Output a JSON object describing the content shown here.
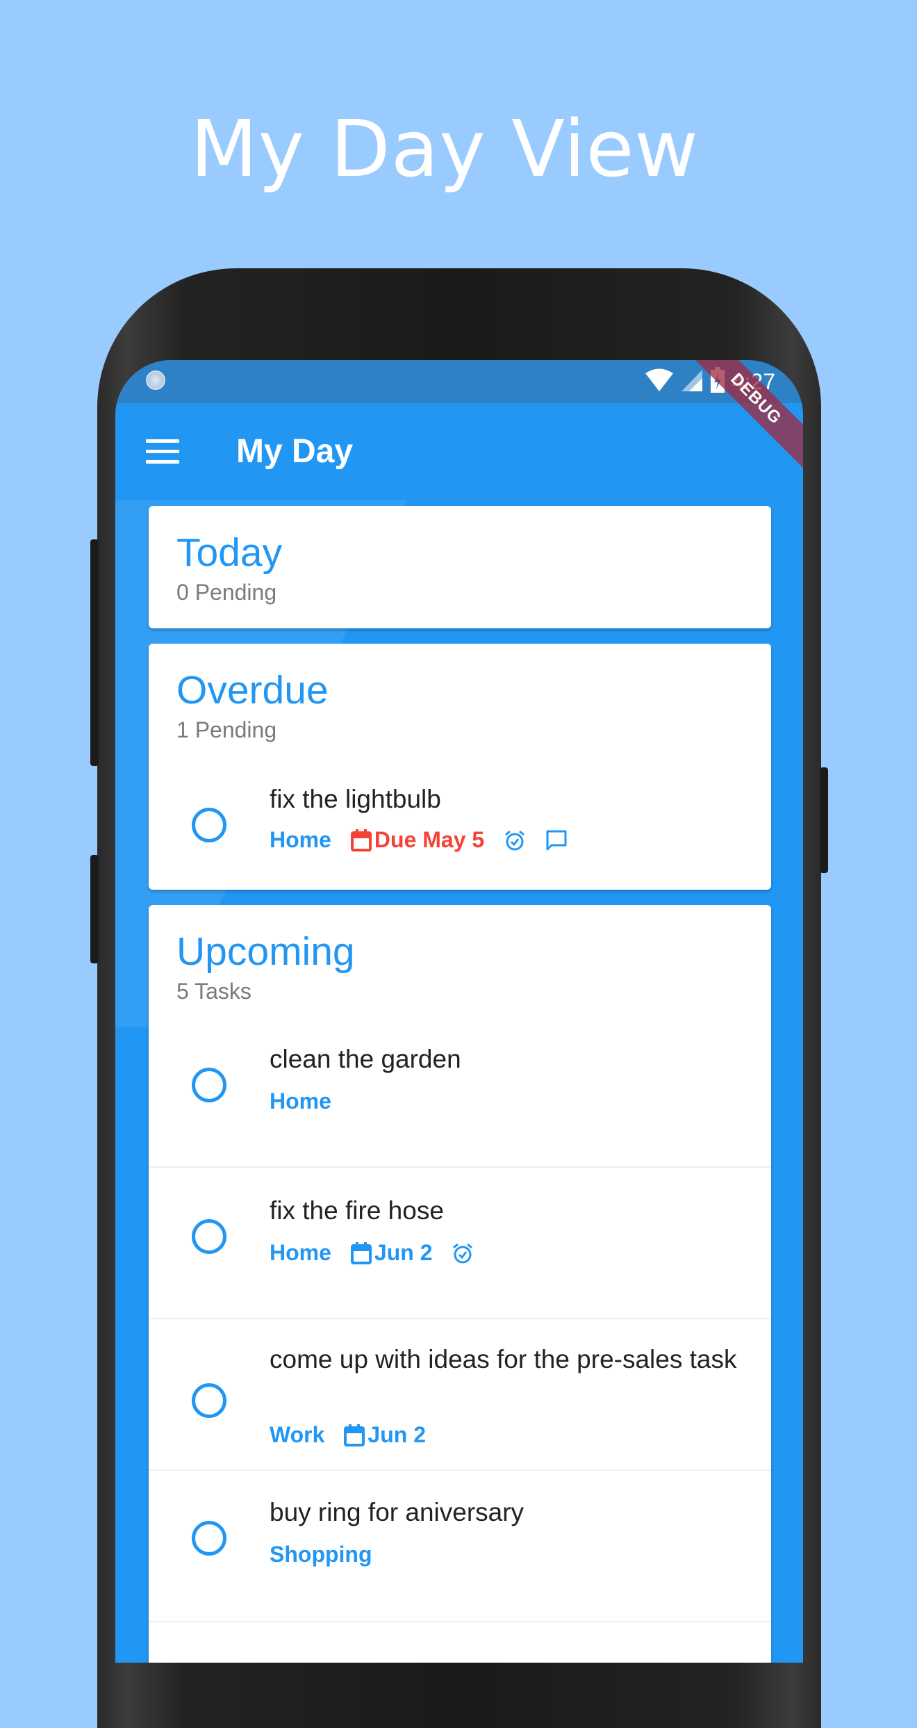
{
  "promo": {
    "title": "My Day View"
  },
  "status_bar": {
    "time": "4:27",
    "debug_label": "DEBUG"
  },
  "app_bar": {
    "title": "My Day"
  },
  "sections": {
    "today": {
      "title": "Today",
      "subtitle": "0 Pending"
    },
    "overdue": {
      "title": "Overdue",
      "subtitle": "1 Pending",
      "tasks": [
        {
          "name": "fix the lightbulb",
          "list": "Home",
          "due": "Due May 5",
          "has_reminder": true,
          "has_comment": true
        }
      ]
    },
    "upcoming": {
      "title": "Upcoming",
      "subtitle": "5 Tasks",
      "tasks": [
        {
          "name": "clean the garden",
          "list": "Home"
        },
        {
          "name": "fix the fire hose",
          "list": "Home",
          "due": "Jun 2",
          "has_reminder": true
        },
        {
          "name": "come up with ideas for the pre-sales task",
          "list": "Work",
          "due": "Jun 2"
        },
        {
          "name": "buy ring for aniversary",
          "list": "Shopping"
        }
      ]
    }
  },
  "colors": {
    "accent": "#2196f3",
    "overdue": "#f44336",
    "background": "#99cbfe"
  }
}
